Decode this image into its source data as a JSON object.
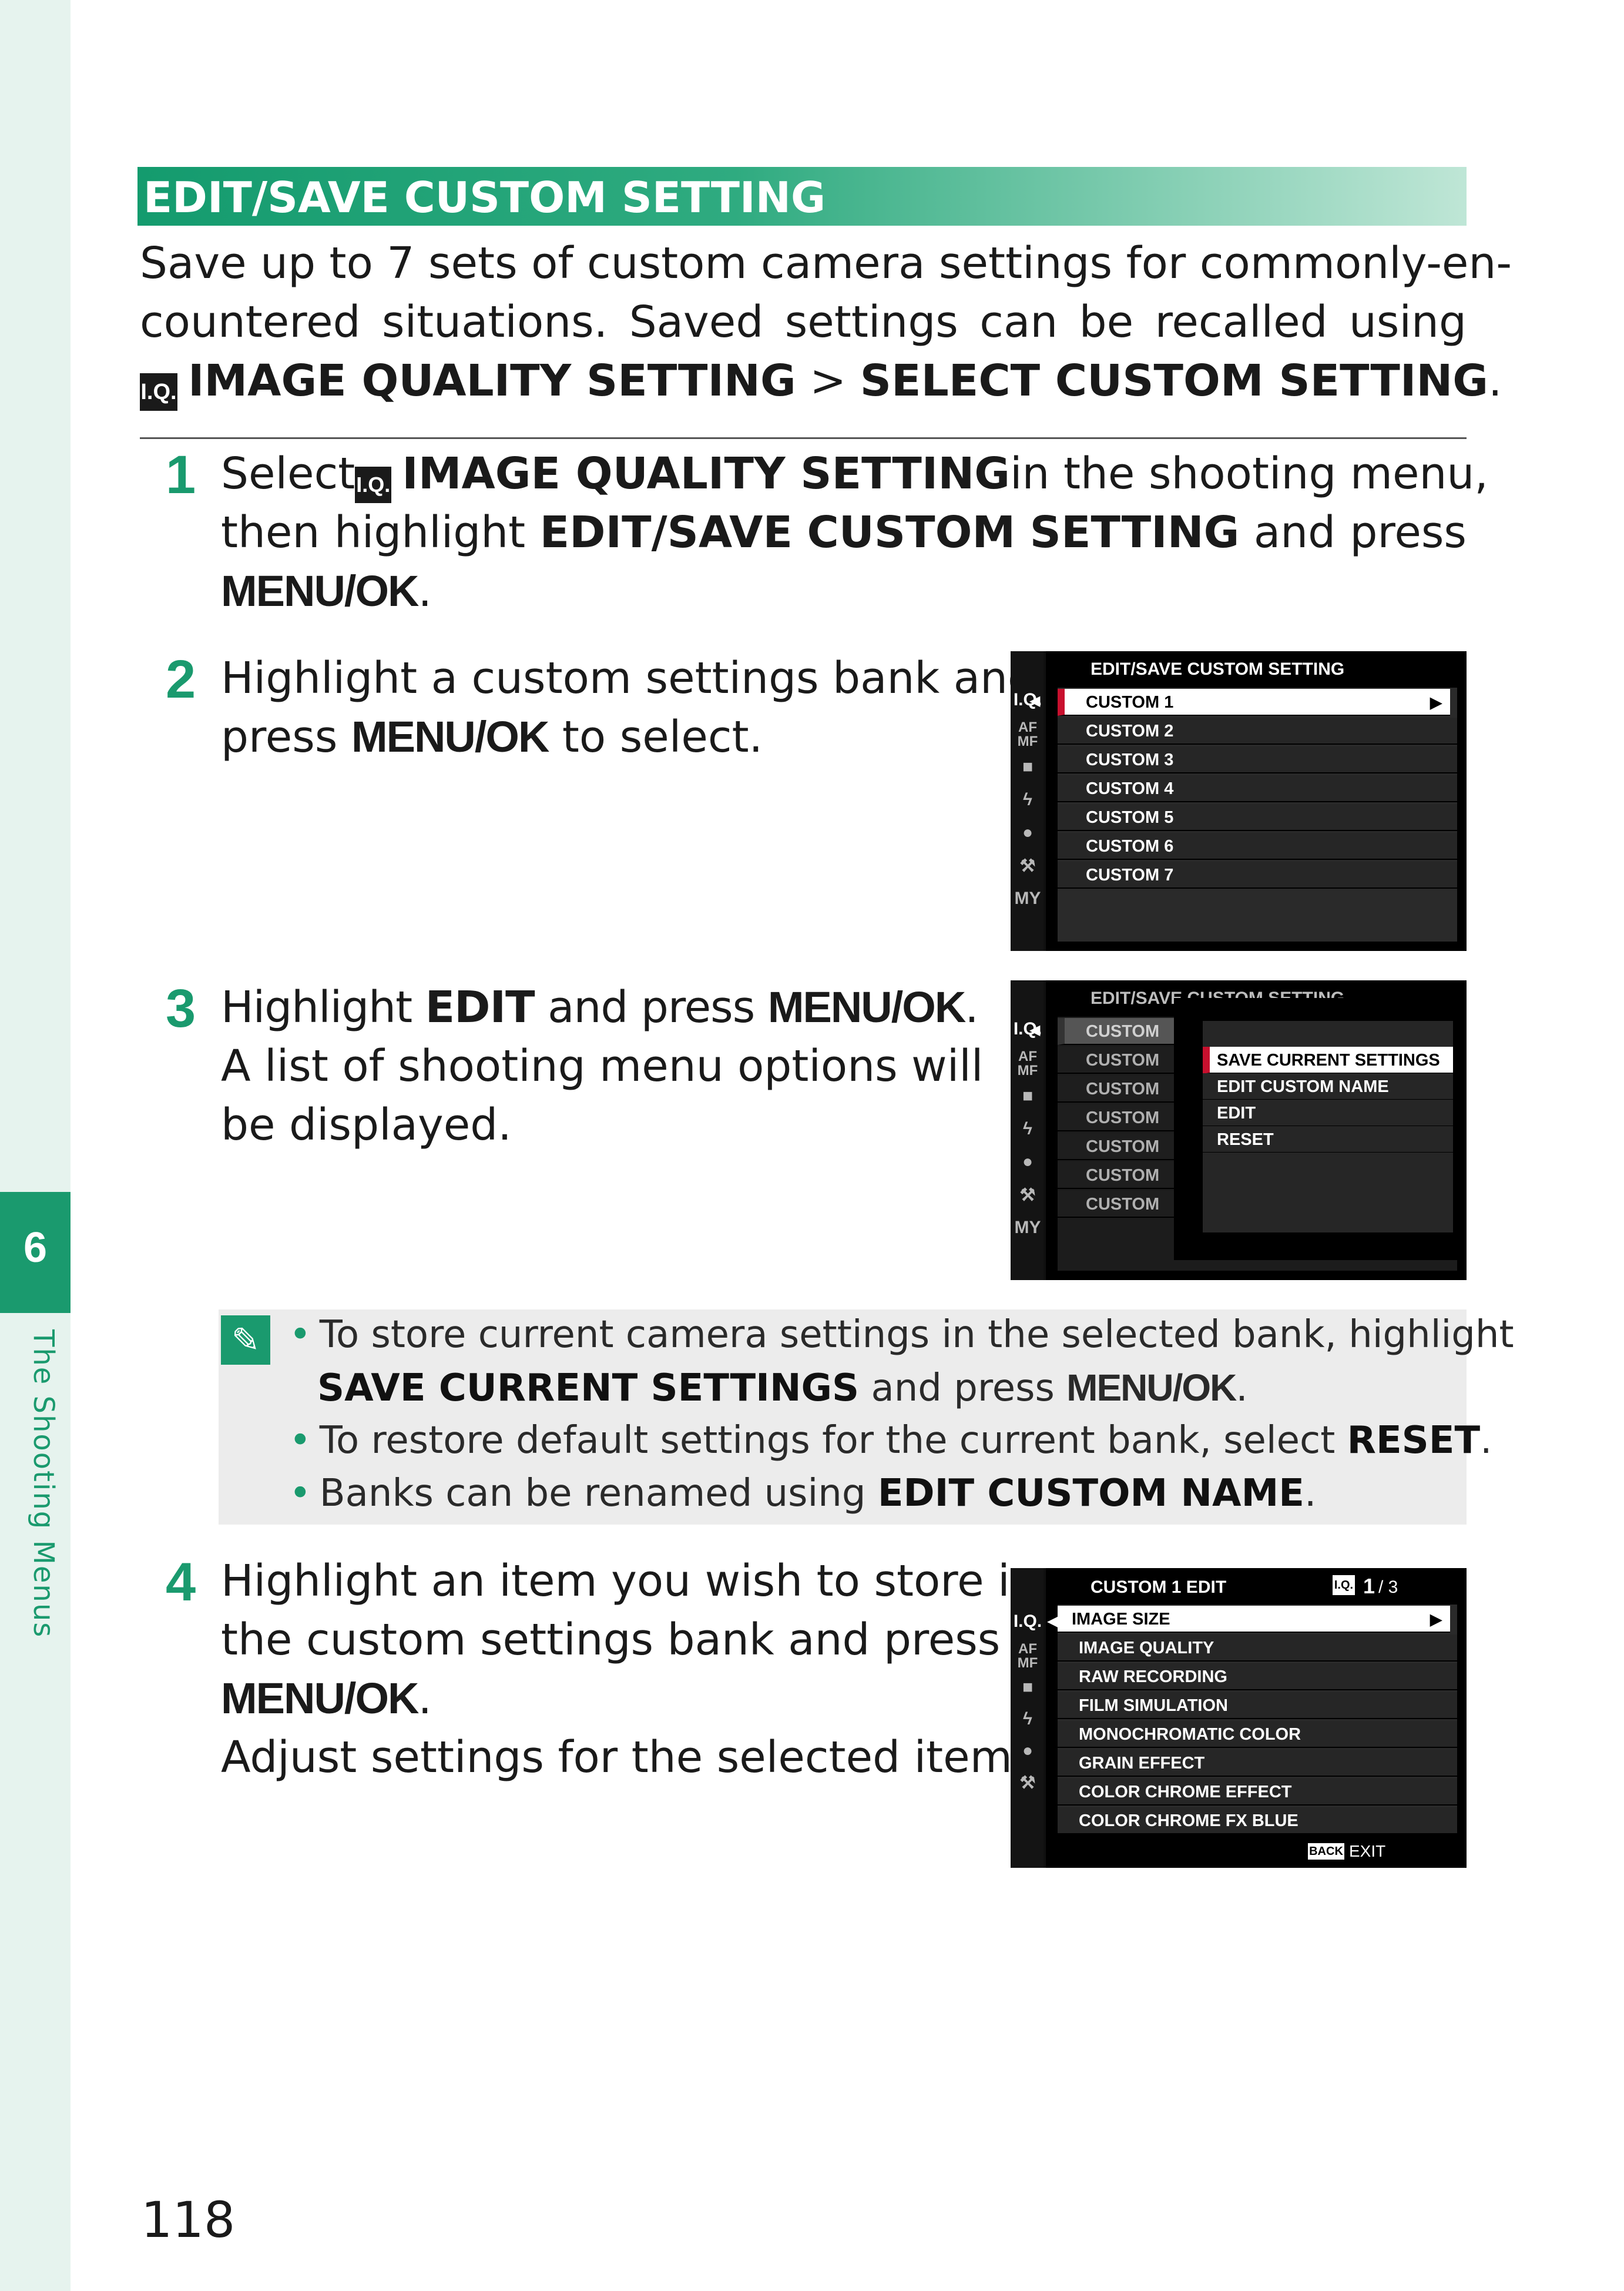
{
  "sidebar": {
    "chapter_number": "6",
    "chapter_label": "The Shooting Menus"
  },
  "page_number": "118",
  "section_title": "EDIT/SAVE CUSTOM SETTING",
  "intro": {
    "line1": "Save up to 7 sets of custom camera settings for commonly-en-",
    "line2_words": [
      "countered",
      "situations.",
      "Saved",
      "settings",
      "can",
      "be",
      "recalled",
      "using"
    ],
    "iq_icon": "I.Q.",
    "menu_path_1": "IMAGE QUALITY SETTING",
    "separator": " > ",
    "menu_path_2": "SELECT CUSTOM SETTING",
    "end": "."
  },
  "steps": [
    {
      "number": "1",
      "select_word": "Select",
      "iq_icon": "I.Q.",
      "menu": "IMAGE QUALITY SETTING",
      "after_menu": "in the shooting menu,",
      "line2_words": [
        "then",
        "highlight",
        "EDIT/SAVE",
        "CUSTOM",
        "SETTING",
        "and",
        "press"
      ],
      "line3": "MENU/OK",
      "line3_end": "."
    },
    {
      "number": "2",
      "line1": "Highlight a custom settings bank and",
      "press": "press ",
      "menu_ok": "MENU/OK",
      "end": " to select."
    },
    {
      "number": "3",
      "highlight": "Highlight ",
      "edit": "EDIT",
      "and_press": " and press ",
      "menu_ok": "MENU/OK",
      "end": ".",
      "line2": "A list of shooting menu options will",
      "line3": "be displayed."
    },
    {
      "number": "4",
      "line1": "Highlight an item you wish to store in",
      "line2": "the custom settings bank and press",
      "line3": "MENU/OK",
      "line3_end": ".",
      "line4": "Adjust settings for the selected item."
    }
  ],
  "screens": {
    "screen1": {
      "title": "EDIT/SAVE CUSTOM SETTING",
      "rows": [
        "CUSTOM 1",
        "CUSTOM 2",
        "CUSTOM 3",
        "CUSTOM 4",
        "CUSTOM 5",
        "CUSTOM 6",
        "CUSTOM 7"
      ],
      "side_icons": [
        "I.Q.",
        "AF MF",
        "camera-icon",
        "flash-icon",
        "movie-icon",
        "wrench-icon",
        "MY"
      ]
    },
    "screen2": {
      "title": "EDIT/SAVE CUSTOM SETTING",
      "background_rows": [
        "CUSTOM",
        "CUSTOM",
        "CUSTOM",
        "CUSTOM",
        "CUSTOM",
        "CUSTOM",
        "CUSTOM"
      ],
      "popup_items": [
        "SAVE CURRENT SETTINGS",
        "EDIT CUSTOM NAME",
        "EDIT",
        "RESET"
      ]
    },
    "screen3": {
      "title": "CUSTOM 1 EDIT",
      "page_icon": "I.Q.",
      "page_current": "1",
      "page_total": "/ 3",
      "rows": [
        "IMAGE SIZE",
        "IMAGE QUALITY",
        "RAW RECORDING",
        "FILM SIMULATION",
        "MONOCHROMATIC COLOR",
        "GRAIN EFFECT",
        "COLOR CHROME EFFECT",
        "COLOR CHROME FX BLUE"
      ],
      "back_button": "BACK",
      "exit_label": "EXIT"
    }
  },
  "notes": [
    {
      "text": "To store current camera settings in the selected bank, highlight",
      "line2_bold": "SAVE CURRENT SETTINGS",
      "line2_mid": " and press ",
      "line2_key": "MENU/OK",
      "line2_end": "."
    },
    {
      "text": "To restore default settings for the current bank, select ",
      "bold": "RESET",
      "end": "."
    },
    {
      "text": "Banks can be renamed using ",
      "bold": "EDIT CUSTOM NAME",
      "end": "."
    }
  ],
  "colors": {
    "accent_green": "#1a9a6e",
    "selection_red": "#c8102e",
    "side_strip": "#e6f3ee",
    "note_bg": "#ececec"
  }
}
